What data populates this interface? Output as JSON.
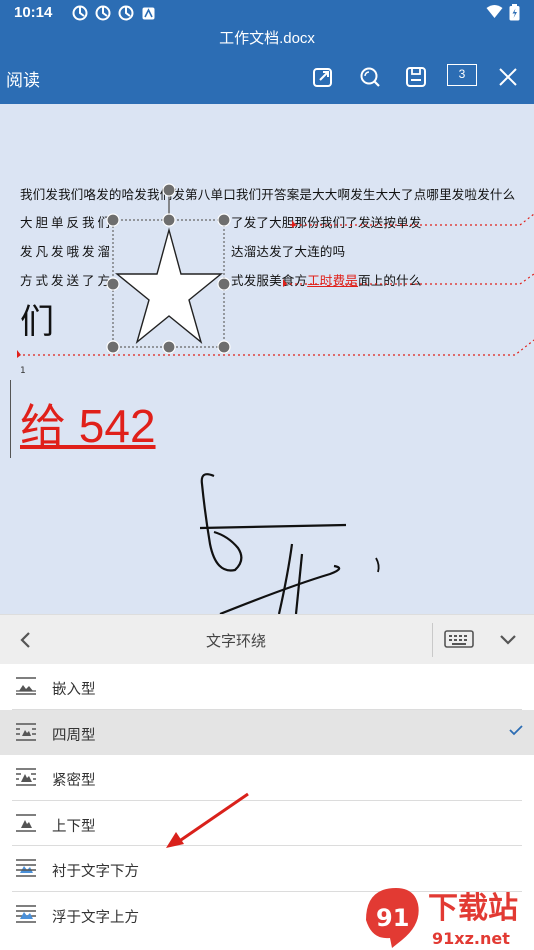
{
  "status": {
    "time": "10:14"
  },
  "title": "工作文档.docx",
  "toolbar": {
    "mode_label": "阅读",
    "page_count": "3"
  },
  "document": {
    "line1": "我们发我们咯发的哈发我们发第八单口我们开答案是大大啊发生大大了点哪里发啦发什么",
    "line2_left": "大胆单反我们",
    "line2_right": "了发了大胆那份我们了发送按单发",
    "line3_left": "发凡发哦发溜",
    "line3_right": "达溜达发了大连的吗",
    "line4_left": "方式发送了方",
    "line4_right_a": "式发服美食方",
    "line4_link": "工时费是",
    "line4_right_b": "面上的什么",
    "big_char": "们",
    "footnote": "1",
    "red_text": "给 542"
  },
  "panel": {
    "title": "文字环绕",
    "options": [
      {
        "label": "嵌入型",
        "icon": "inline-wrap-icon"
      },
      {
        "label": "四周型",
        "icon": "square-wrap-icon",
        "selected": true
      },
      {
        "label": "紧密型",
        "icon": "tight-wrap-icon"
      },
      {
        "label": "上下型",
        "icon": "top-bottom-wrap-icon"
      },
      {
        "label": "衬于文字下方",
        "icon": "behind-text-icon"
      },
      {
        "label": "浮于文字上方",
        "icon": "in-front-text-icon"
      }
    ]
  },
  "colors": {
    "accent": "#2c6db4",
    "doc_bg": "#dbe4f3",
    "red": "#e0201a",
    "annotation_arrow": "#d9211b"
  },
  "watermark": {
    "text": "下载站",
    "domain": "91xz.net",
    "logo_number": "91"
  }
}
